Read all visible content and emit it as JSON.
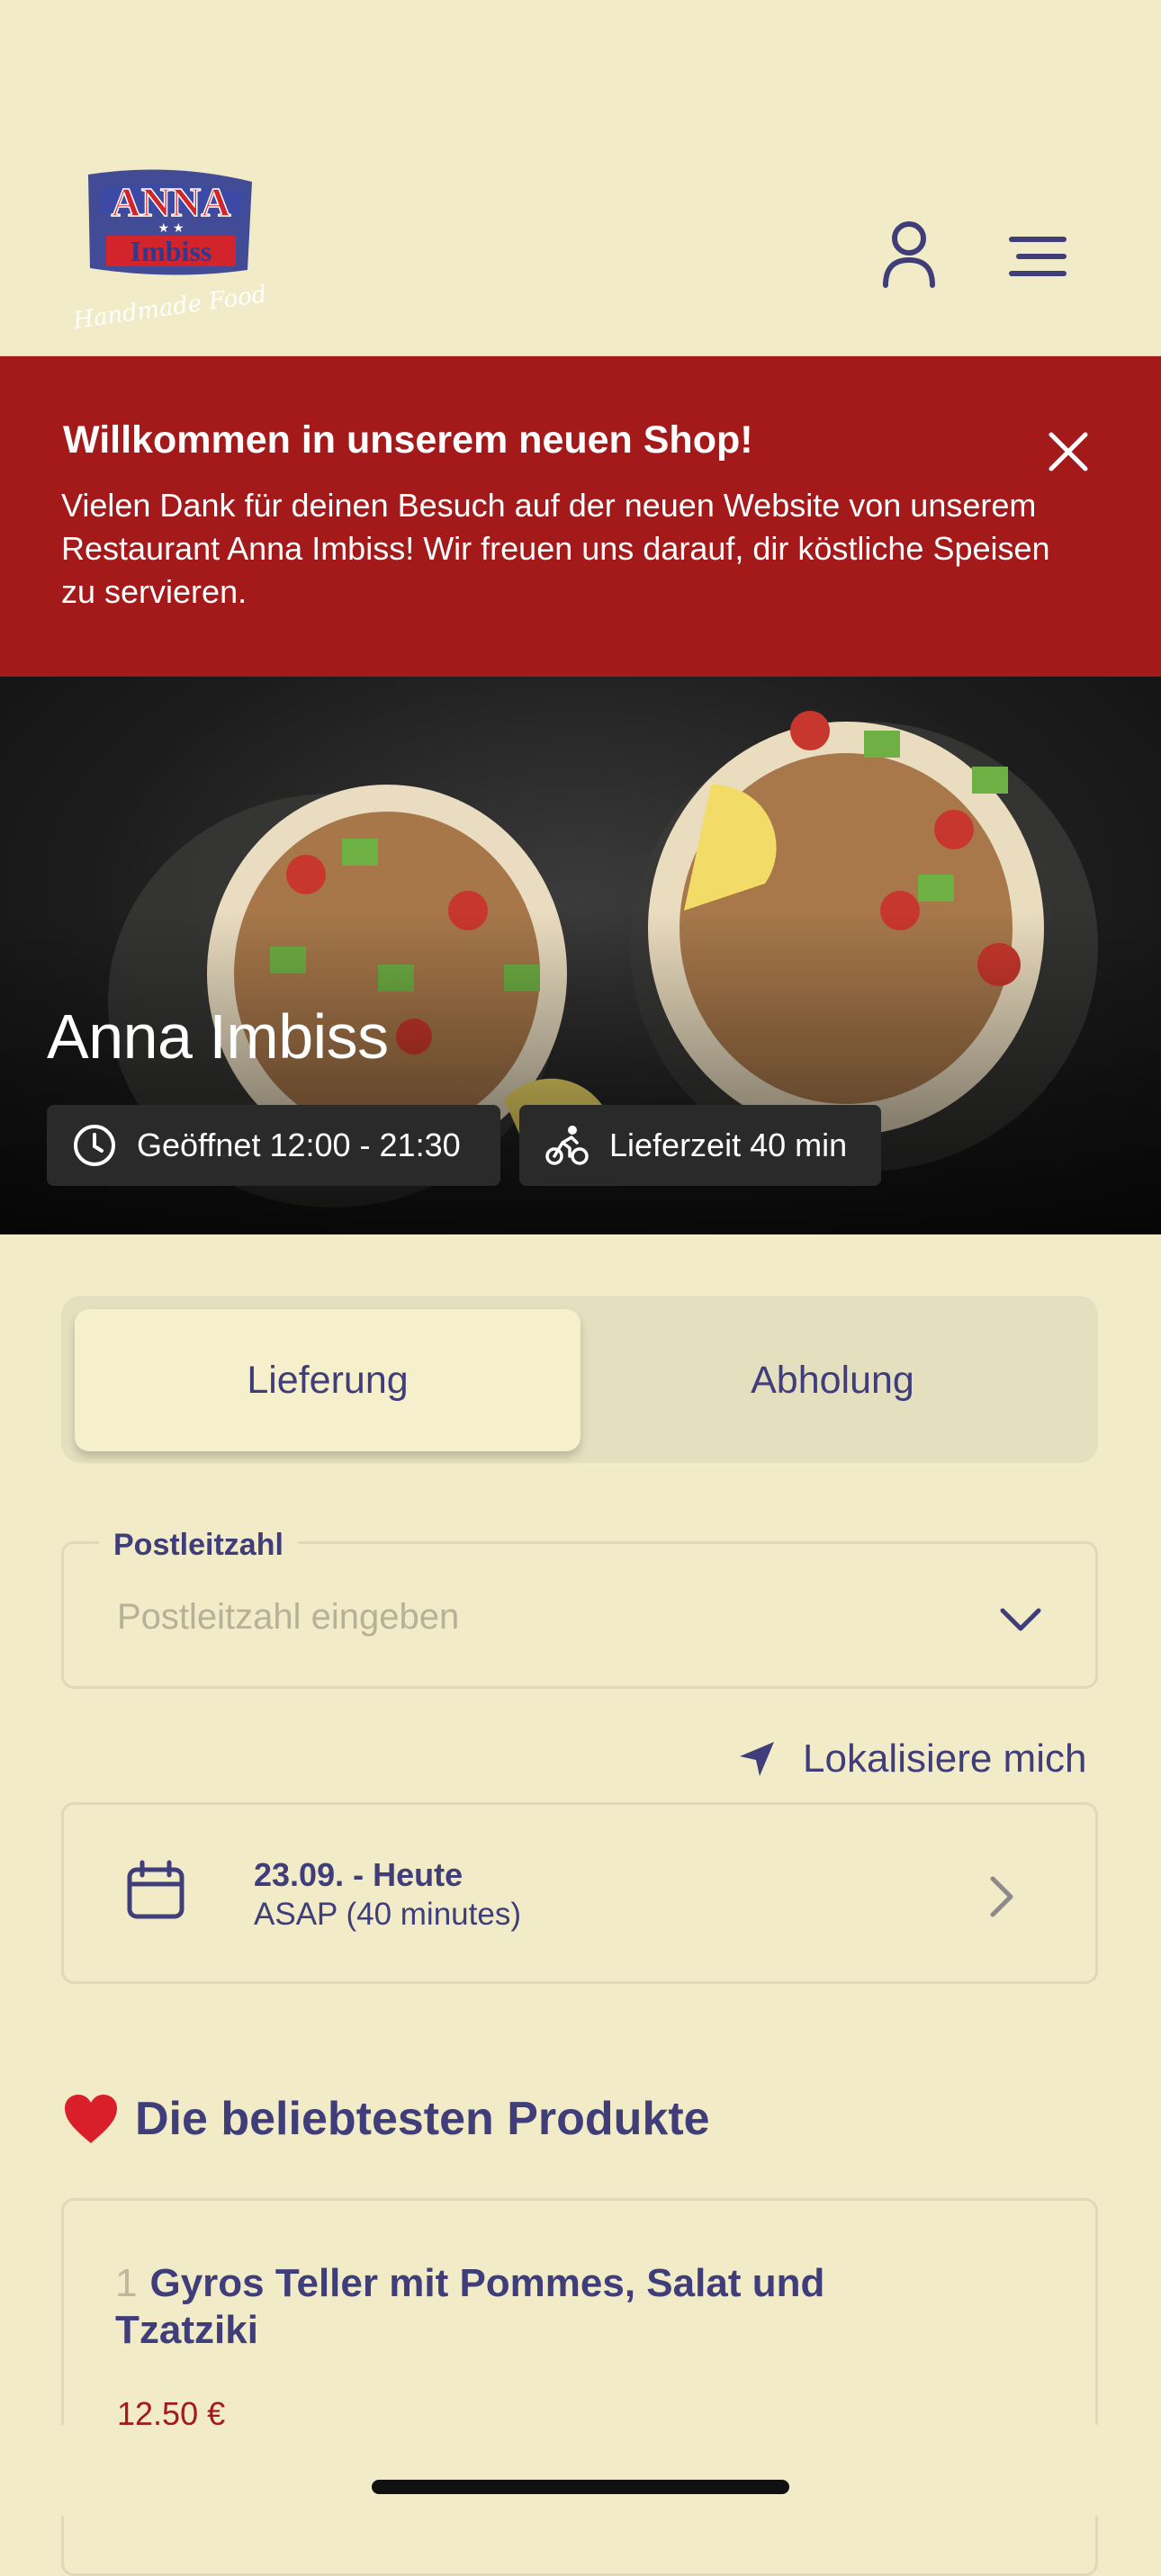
{
  "header": {
    "logo": {
      "line1": "ANNA",
      "line2": "Imbiss",
      "tagline": "Handmade Food"
    }
  },
  "banner": {
    "title": "Willkommen in unserem neuen Shop!",
    "text": "Vielen Dank für deinen Besuch auf der neuen Website von unserem Restaurant Anna Imbiss! Wir freuen uns darauf, dir köstliche Speisen zu servieren."
  },
  "hero": {
    "restaurant_name": "Anna Imbiss",
    "hours": "Geöffnet 12:00 - 21:30",
    "delivery_time": "Lieferzeit 40 min"
  },
  "order_mode": {
    "tabs": [
      "Lieferung",
      "Abholung"
    ],
    "selected": "Lieferung"
  },
  "postal": {
    "label": "Postleitzahl",
    "placeholder": "Postleitzahl eingeben",
    "value": ""
  },
  "locate_label": "Lokalisiere mich",
  "schedule": {
    "date": "23.09. - Heute",
    "time": "ASAP (40 minutes)"
  },
  "popular": {
    "heading": "Die beliebtesten Produkte",
    "products": [
      {
        "index": "1",
        "name": "Gyros Teller mit Pommes, Salat und Tzatziki",
        "price": "12.50 €"
      }
    ]
  },
  "colors": {
    "background": "#f1ebc7",
    "primary": "#3f3e7a",
    "banner": "#a4191a",
    "price": "#a4191a"
  }
}
